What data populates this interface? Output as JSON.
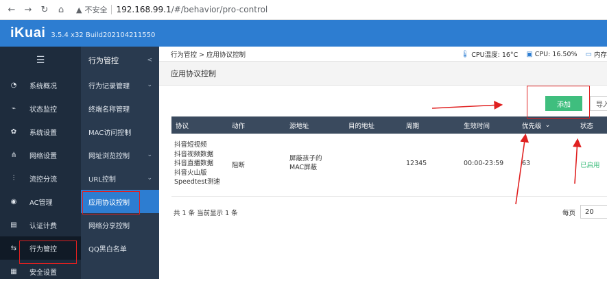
{
  "browser": {
    "insecure_label": "不安全",
    "url_host": "192.168.99.1",
    "url_path": "/#/behavior/pro-control"
  },
  "app": {
    "logo": "iKuai",
    "build": "3.5.4 x32 Build202104211550"
  },
  "sidebar": {
    "items": [
      {
        "label": "系统概况",
        "icon": "gauge-icon"
      },
      {
        "label": "状态监控",
        "icon": "monitor-icon"
      },
      {
        "label": "系统设置",
        "icon": "gear-icon"
      },
      {
        "label": "网络设置",
        "icon": "network-icon"
      },
      {
        "label": "流控分流",
        "icon": "sliders-icon"
      },
      {
        "label": "AC管理",
        "icon": "wifi-icon"
      },
      {
        "label": "认证计费",
        "icon": "id-card-icon"
      },
      {
        "label": "行为管控",
        "icon": "swap-icon"
      },
      {
        "label": "安全设置",
        "icon": "grid-icon"
      }
    ]
  },
  "subnav": {
    "title": "行为管控",
    "items": [
      {
        "label": "行为记录管理",
        "chevron": true
      },
      {
        "label": "终端名称管理",
        "chevron": false
      },
      {
        "label": "MAC访问控制",
        "chevron": false
      },
      {
        "label": "网址浏览控制",
        "chevron": true
      },
      {
        "label": "URL控制",
        "chevron": true
      },
      {
        "label": "应用协议控制",
        "chevron": false
      },
      {
        "label": "网络分享控制",
        "chevron": false
      },
      {
        "label": "QQ黑白名单",
        "chevron": false
      }
    ]
  },
  "main": {
    "breadcrumb": "行为管控 > 应用协议控制",
    "stats": {
      "cpu_temp": "CPU温度: 16°C",
      "cpu": "CPU: 16.50%",
      "mem": "内存"
    },
    "page_title": "应用协议控制",
    "add_label": "添加",
    "import_label": "导入",
    "columns": [
      "协议",
      "动作",
      "源地址",
      "目的地址",
      "周期",
      "生效时间",
      "优先级",
      "状态"
    ],
    "row": {
      "protocols": [
        "抖音短视频",
        "抖音视频数据",
        "抖音直播数据",
        "抖音火山版",
        "Speedtest测速"
      ],
      "action": "阻断",
      "source": [
        "屏蔽孩子的",
        "MAC屏蔽"
      ],
      "dest": "",
      "period": "12345",
      "time": "00:00-23:59",
      "priority": "63",
      "status": "已启用"
    },
    "footer_text": "共 1 条 当前显示 1 条",
    "per_page_label": "每页",
    "per_page_value": "20"
  },
  "colors": {
    "brand": "#2d7dd1",
    "sidebar": "#1e2c3d",
    "add_button": "#3fbe7e",
    "annotation": "#e02020"
  }
}
